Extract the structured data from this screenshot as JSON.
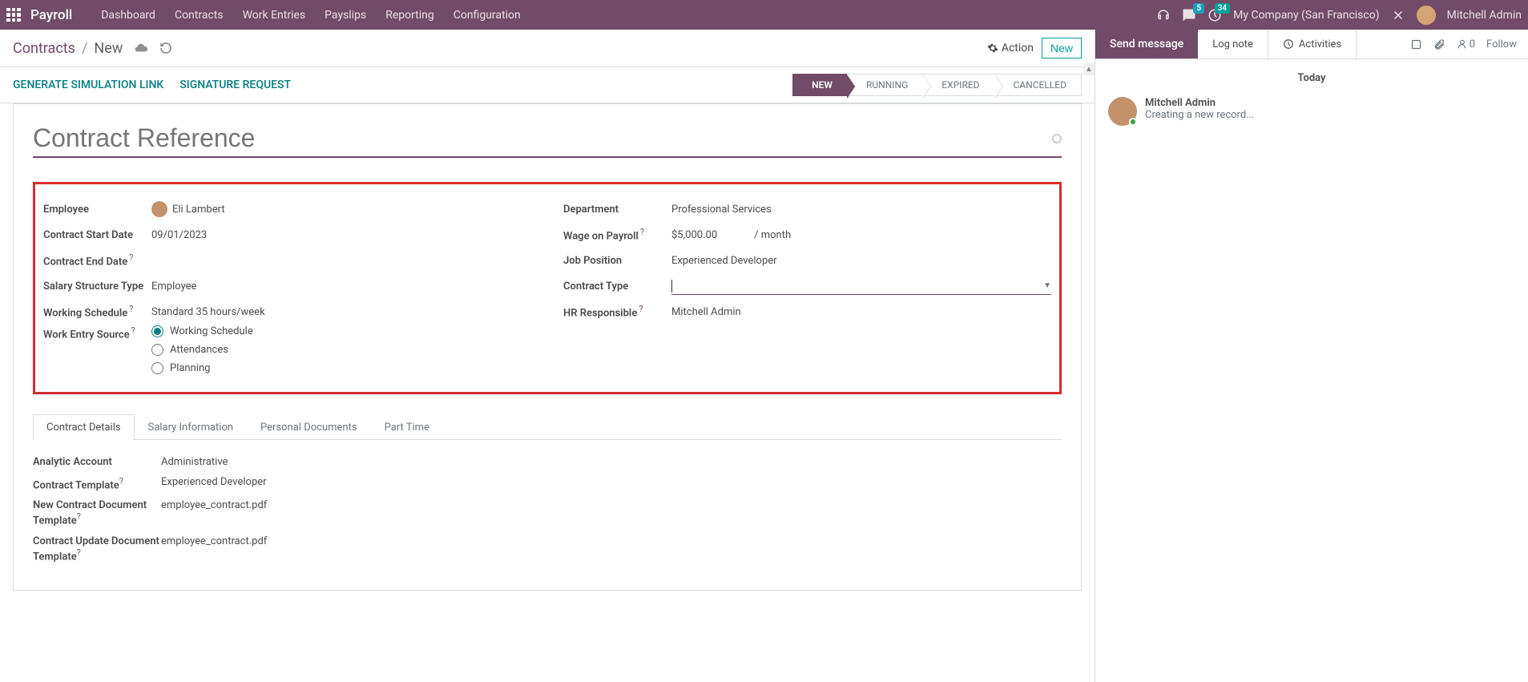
{
  "navbar": {
    "app_title": "Payroll",
    "menu": [
      "Dashboard",
      "Contracts",
      "Work Entries",
      "Payslips",
      "Reporting",
      "Configuration"
    ],
    "messages_count": "5",
    "activities_count": "34",
    "company": "My Company (San Francisco)",
    "user": "Mitchell Admin"
  },
  "breadcrumb": {
    "parent": "Contracts",
    "current": "New"
  },
  "control": {
    "action": "Action",
    "new": "New"
  },
  "statusbar": {
    "left": [
      "GENERATE SIMULATION LINK",
      "SIGNATURE REQUEST"
    ],
    "stages": [
      "NEW",
      "RUNNING",
      "EXPIRED",
      "CANCELLED"
    ]
  },
  "form": {
    "title_placeholder": "Contract Reference",
    "labels": {
      "employee": "Employee",
      "start": "Contract Start Date",
      "end": "Contract End Date",
      "structure": "Salary Structure Type",
      "schedule": "Working Schedule",
      "source": "Work Entry Source",
      "department": "Department",
      "wage": "Wage on Payroll",
      "position": "Job Position",
      "type": "Contract Type",
      "hr": "HR Responsible"
    },
    "values": {
      "employee": "Eli Lambert",
      "start": "09/01/2023",
      "structure": "Employee",
      "schedule": "Standard 35 hours/week",
      "department": "Professional Services",
      "wage": "$5,000.00",
      "wage_unit": "/ month",
      "position": "Experienced Developer",
      "hr": "Mitchell Admin"
    },
    "radios": {
      "r1": "Working Schedule",
      "r2": "Attendances",
      "r3": "Planning"
    }
  },
  "tabs": {
    "t1": "Contract Details",
    "t2": "Salary Information",
    "t3": "Personal Documents",
    "t4": "Part Time"
  },
  "details": {
    "labels": {
      "analytic": "Analytic Account",
      "template": "Contract Template",
      "newdoc": "New Contract Document Template",
      "update": "Contract Update Document Template"
    },
    "values": {
      "analytic": "Administrative",
      "template": "Experienced Developer",
      "newdoc": "employee_contract.pdf",
      "update": "employee_contract.pdf"
    }
  },
  "chatter": {
    "send": "Send message",
    "lognote": "Log note",
    "activities": "Activities",
    "follower_count": "0",
    "follow": "Follow",
    "today": "Today",
    "msg_author": "Mitchell Admin",
    "msg_text": "Creating a new record..."
  }
}
